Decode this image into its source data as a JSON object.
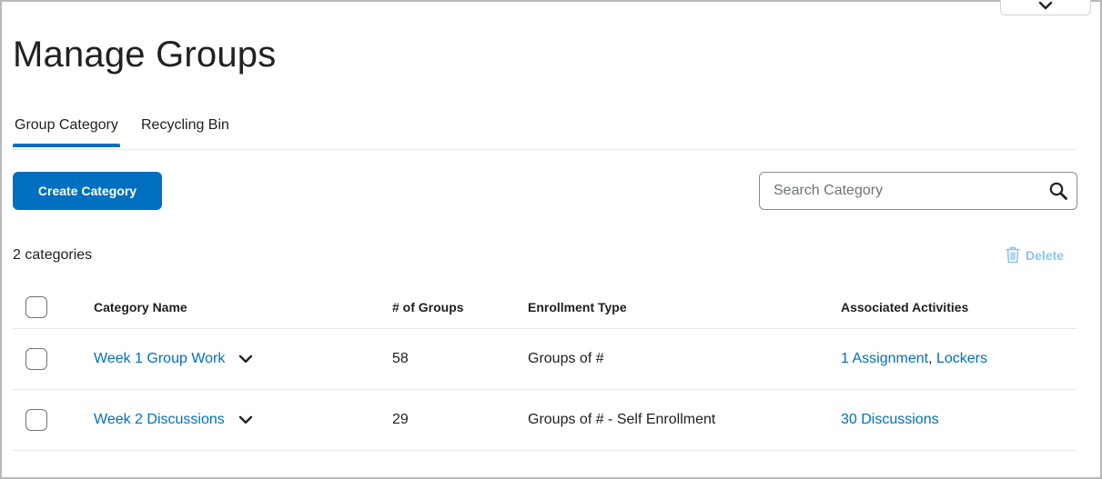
{
  "page": {
    "title": "Manage Groups"
  },
  "tabs": [
    {
      "label": "Group Category",
      "active": true
    },
    {
      "label": "Recycling Bin",
      "active": false
    }
  ],
  "toolbar": {
    "create_label": "Create Category",
    "search_placeholder": "Search Category",
    "search_value": ""
  },
  "summary": {
    "count_text": "2 categories",
    "delete_label": "Delete"
  },
  "table": {
    "headers": [
      "Category Name",
      "# of Groups",
      "Enrollment Type",
      "Associated Activities"
    ],
    "rows": [
      {
        "name": "Week 1 Group Work",
        "groups": "58",
        "enrollment": "Groups of #",
        "activities": [
          "1 Assignment",
          "Lockers"
        ]
      },
      {
        "name": "Week 2 Discussions",
        "groups": "29",
        "enrollment": "Groups of # - Self Enrollment",
        "activities": [
          "30 Discussions"
        ]
      }
    ]
  },
  "colors": {
    "primary": "#006fbf",
    "delete_disabled": "#8ec4e8",
    "text": "#202122",
    "divider": "#e3e9f1"
  },
  "icons": {
    "top_dropdown": "chevron-down-icon",
    "search": "search-icon",
    "delete": "trash-icon",
    "row_menu": "chevron-down-icon"
  }
}
